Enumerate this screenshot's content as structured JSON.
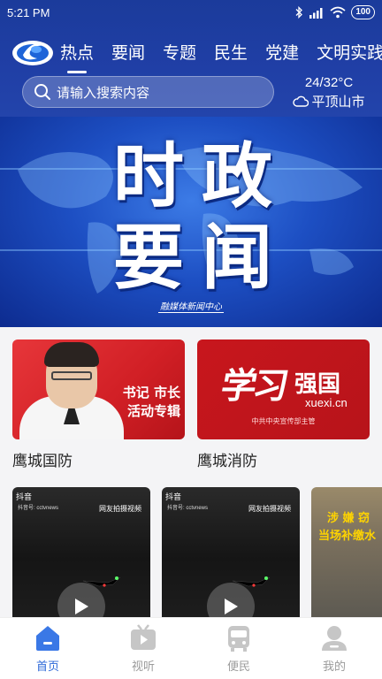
{
  "status_bar": {
    "time": "5:21 PM",
    "battery": "100"
  },
  "nav_tabs": [
    {
      "label": "热点",
      "active": true
    },
    {
      "label": "要闻",
      "active": false
    },
    {
      "label": "专题",
      "active": false
    },
    {
      "label": "民生",
      "active": false
    },
    {
      "label": "党建",
      "active": false
    },
    {
      "label": "文明实践",
      "active": false
    }
  ],
  "search": {
    "placeholder": "请输入搜索内容"
  },
  "weather": {
    "temperature": "24/32°C",
    "city": "平顶山市",
    "icon": "cloud-icon"
  },
  "banner": {
    "characters": [
      "时",
      "政",
      "要",
      "闻"
    ],
    "footer": "融媒体新闻中心"
  },
  "cards": [
    {
      "title": "鹰城国防",
      "image_text": [
        "书记 市长",
        "活动专辑"
      ]
    },
    {
      "title": "鹰城消防",
      "image_brush": "学习",
      "image_main": "强国",
      "image_url": "xuexi.cn",
      "image_sub": "中共中央宣传部主管"
    }
  ],
  "videos": [
    {
      "platform": "抖音",
      "account": "抖音号: cctvnews",
      "tag": "网友拍摄视频"
    },
    {
      "platform": "抖音",
      "account": "抖音号: cctvnews",
      "tag": "网友拍摄视频"
    },
    {
      "overlay_line1": "涉 嫌 窃",
      "overlay_line2": "当场补缴水"
    }
  ],
  "bottom_nav": [
    {
      "label": "首页",
      "icon": "home-icon",
      "active": true
    },
    {
      "label": "视听",
      "icon": "tv-icon",
      "active": false
    },
    {
      "label": "便民",
      "icon": "bus-icon",
      "active": false
    },
    {
      "label": "我的",
      "icon": "user-icon",
      "active": false
    }
  ],
  "colors": {
    "header_blue": "#1b3b9b",
    "accent_blue": "#2f6ad8",
    "card_red": "#d11f25"
  }
}
